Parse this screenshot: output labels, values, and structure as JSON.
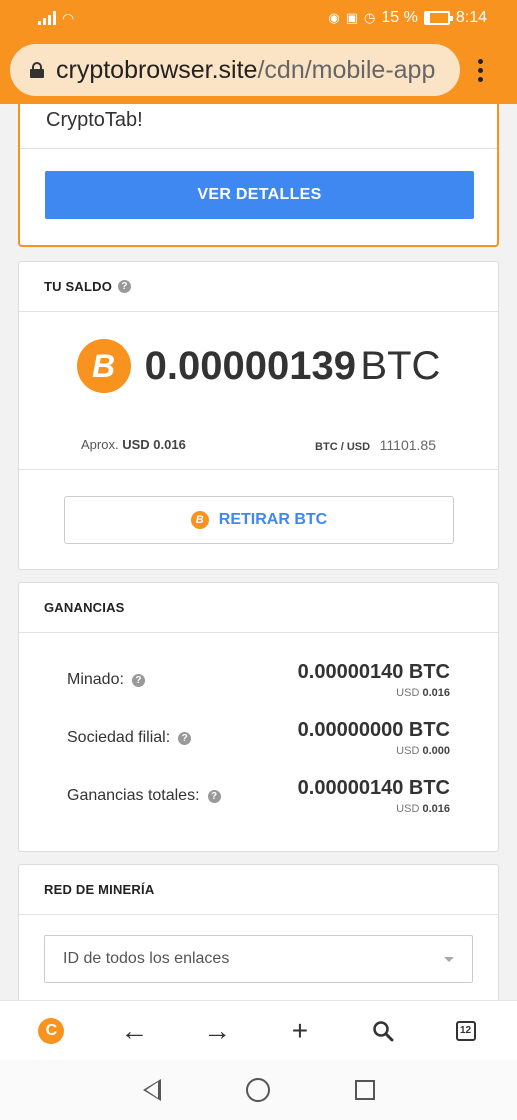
{
  "status_bar": {
    "battery": "15 %",
    "time": "8:14"
  },
  "browser": {
    "url_host": "cryptobrowser.site",
    "url_path": "/cdn/mobile-app"
  },
  "promo": {
    "title": "CryptoTab!",
    "button": "VER DETALLES"
  },
  "balance": {
    "header": "TU SALDO",
    "amount": "0.00000139",
    "unit": "BTC",
    "approx_label": "Aprox.",
    "approx_value": "USD 0.016",
    "rate_label": "BTC / USD",
    "rate_value": "11101.85",
    "withdraw_button": "RETIRAR BTC",
    "btc_symbol": "B"
  },
  "earnings": {
    "header": "GANANCIAS",
    "rows": [
      {
        "label": "Minado:",
        "btc": "0.00000140 BTC",
        "usd_label": "USD",
        "usd": "0.016"
      },
      {
        "label": "Sociedad filial:",
        "btc": "0.00000000 BTC",
        "usd_label": "USD",
        "usd": "0.000"
      },
      {
        "label": "Ganancias totales:",
        "btc": "0.00000140 BTC",
        "usd_label": "USD",
        "usd": "0.016"
      }
    ]
  },
  "network": {
    "header": "RED DE MINERÍA",
    "select_value": "ID de todos los enlaces"
  },
  "toolbar": {
    "tabs_count": "12",
    "logo": "C"
  },
  "colors": {
    "accent": "#f7931e",
    "primary": "#3f88f2"
  }
}
